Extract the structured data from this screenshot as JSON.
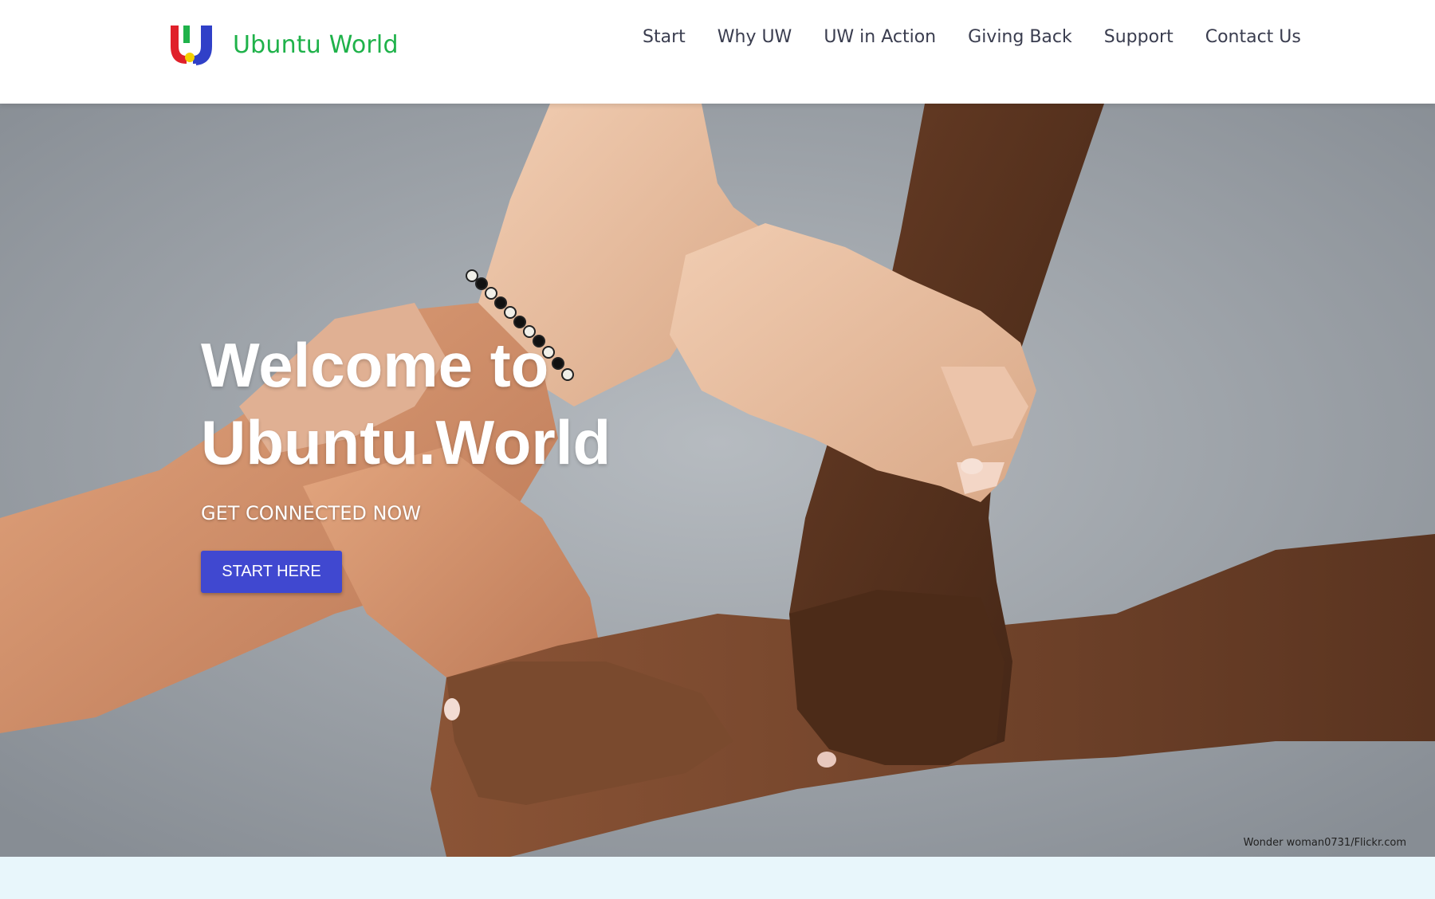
{
  "header": {
    "brand": "Ubuntu World",
    "logo_icon": "ubuntu-world-logo",
    "nav": [
      "Start",
      "Why UW",
      "UW in Action",
      "Giving Back",
      "Support",
      "Contact Us"
    ]
  },
  "hero": {
    "title_line1": "Welcome to",
    "title_line2": "Ubuntu.World",
    "subtitle": "GET CONNECTED NOW",
    "cta_label": "START HERE",
    "image_credit": "Wonder woman0731/Flickr.com",
    "image_description": "hands-holding-wrists-in-a-ring"
  },
  "colors": {
    "brand_green": "#1fb24a",
    "cta_blue": "#4048d0",
    "nav_text": "#3a3d4f",
    "logo_red": "#e0202a",
    "logo_blue": "#3040c8",
    "logo_yellow": "#f4d000",
    "section_bg": "#e8f6fb"
  }
}
